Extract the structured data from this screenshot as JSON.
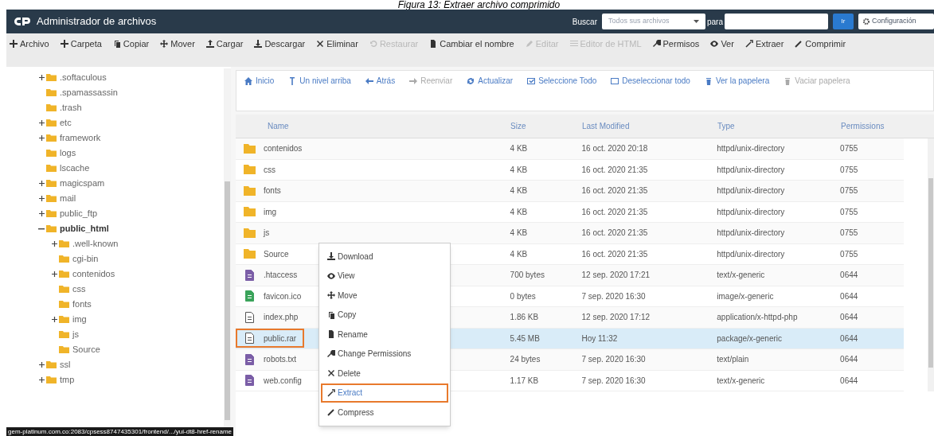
{
  "caption": "Figura 13: Extraer archivo comprimido",
  "header": {
    "title": "Administrador de archivos",
    "search_label": "Buscar",
    "search_scope": "Todos sus archivos",
    "for_label": "para",
    "go_button": "Ir",
    "settings_button": "Configuración"
  },
  "toolbar": [
    {
      "label": "Archivo",
      "disabled": false
    },
    {
      "label": "Carpeta",
      "disabled": false
    },
    {
      "label": "Copiar",
      "disabled": false
    },
    {
      "label": "Mover",
      "disabled": false
    },
    {
      "label": "Cargar",
      "disabled": false
    },
    {
      "label": "Descargar",
      "disabled": false
    },
    {
      "label": "Eliminar",
      "disabled": false
    },
    {
      "label": "Restaurar",
      "disabled": true
    },
    {
      "label": "Cambiar el nombre",
      "disabled": false
    },
    {
      "label": "Editar",
      "disabled": true
    },
    {
      "label": "Editor de HTML",
      "disabled": true
    },
    {
      "label": "Permisos",
      "disabled": false
    },
    {
      "label": "Ver",
      "disabled": false
    },
    {
      "label": "Extraer",
      "disabled": false
    },
    {
      "label": "Comprimir",
      "disabled": false
    }
  ],
  "tree": [
    {
      "label": ".softaculous",
      "expanded": false,
      "selected": false
    },
    {
      "label": ".spamassassin",
      "selected": false
    },
    {
      "label": ".trash",
      "selected": false
    },
    {
      "label": "etc",
      "expanded": false,
      "selected": false
    },
    {
      "label": "framework",
      "expanded": false,
      "selected": false
    },
    {
      "label": "logs",
      "selected": false
    },
    {
      "label": "lscache",
      "selected": false
    },
    {
      "label": "magicspam",
      "expanded": false,
      "selected": false
    },
    {
      "label": "mail",
      "expanded": false,
      "selected": false
    },
    {
      "label": "public_ftp",
      "expanded": false,
      "selected": false
    },
    {
      "label": "public_html",
      "expanded": true,
      "selected": true,
      "children": [
        {
          "label": ".well-known",
          "expanded": false,
          "selected": false
        },
        {
          "label": "cgi-bin",
          "selected": false
        },
        {
          "label": "contenidos",
          "expanded": false,
          "selected": false
        },
        {
          "label": "css",
          "selected": false
        },
        {
          "label": "fonts",
          "selected": false
        },
        {
          "label": "img",
          "expanded": false,
          "selected": false
        },
        {
          "label": "js",
          "selected": false
        },
        {
          "label": "Source",
          "selected": false
        }
      ]
    },
    {
      "label": "ssl",
      "expanded": false,
      "selected": false
    },
    {
      "label": "tmp",
      "expanded": false,
      "selected": false
    }
  ],
  "actions": [
    {
      "label": "Inicio",
      "disabled": false
    },
    {
      "label": "Un nivel arriba",
      "disabled": false
    },
    {
      "label": "Atrás",
      "disabled": false
    },
    {
      "label": "Reenviar",
      "disabled": true
    },
    {
      "label": "Actualizar",
      "disabled": false
    },
    {
      "label": "Seleccione Todo",
      "disabled": false
    },
    {
      "label": "Deseleccionar todo",
      "disabled": false
    },
    {
      "label": "Ver la papelera",
      "disabled": false
    },
    {
      "label": "Vaciar papelera",
      "disabled": true
    }
  ],
  "table": {
    "columns": [
      "Name",
      "Size",
      "Last Modified",
      "Type",
      "Permissions"
    ],
    "rows": [
      {
        "kind": "folder",
        "name": "contenidos",
        "size": "4 KB",
        "modified": "16 oct. 2020 20:18",
        "type": "httpd/unix-directory",
        "permissions": "0755",
        "selected": false,
        "highlighted": false
      },
      {
        "kind": "folder",
        "name": "css",
        "size": "4 KB",
        "modified": "16 oct. 2020 21:35",
        "type": "httpd/unix-directory",
        "permissions": "0755",
        "selected": false,
        "highlighted": false
      },
      {
        "kind": "folder",
        "name": "fonts",
        "size": "4 KB",
        "modified": "16 oct. 2020 21:35",
        "type": "httpd/unix-directory",
        "permissions": "0755",
        "selected": false,
        "highlighted": false
      },
      {
        "kind": "folder",
        "name": "img",
        "size": "4 KB",
        "modified": "16 oct. 2020 21:35",
        "type": "httpd/unix-directory",
        "permissions": "0755",
        "selected": false,
        "highlighted": false
      },
      {
        "kind": "folder",
        "name": "js",
        "size": "4 KB",
        "modified": "16 oct. 2020 21:35",
        "type": "httpd/unix-directory",
        "permissions": "0755",
        "selected": false,
        "highlighted": false
      },
      {
        "kind": "folder",
        "name": "Source",
        "size": "4 KB",
        "modified": "16 oct. 2020 21:35",
        "type": "httpd/unix-directory",
        "permissions": "0755",
        "selected": false,
        "highlighted": false
      },
      {
        "kind": "text",
        "name": ".htaccess",
        "size": "700 bytes",
        "modified": "12 sep. 2020 17:21",
        "type": "text/x-generic",
        "permissions": "0644",
        "selected": false,
        "highlighted": false
      },
      {
        "kind": "image",
        "name": "favicon.ico",
        "size": "0 bytes",
        "modified": "7 sep. 2020 16:30",
        "type": "image/x-generic",
        "permissions": "0644",
        "selected": false,
        "highlighted": false
      },
      {
        "kind": "code",
        "name": "index.php",
        "size": "1.86 KB",
        "modified": "12 sep. 2020 17:12",
        "type": "application/x-httpd-php",
        "permissions": "0644",
        "selected": false,
        "highlighted": false
      },
      {
        "kind": "archive",
        "name": "public.rar",
        "size": "5.45 MB",
        "modified": "Hoy 11:32",
        "type": "package/x-generic",
        "permissions": "0644",
        "selected": true,
        "highlighted": true
      },
      {
        "kind": "text",
        "name": "robots.txt",
        "size": "24 bytes",
        "modified": "7 sep. 2020 16:30",
        "type": "text/plain",
        "permissions": "0644",
        "selected": false,
        "highlighted": false
      },
      {
        "kind": "text",
        "name": "web.config",
        "size": "1.17 KB",
        "modified": "7 sep. 2020 16:30",
        "type": "text/x-generic",
        "permissions": "0644",
        "selected": false,
        "highlighted": false
      }
    ]
  },
  "context_menu": [
    {
      "label": "Download",
      "highlighted": false
    },
    {
      "label": "View",
      "highlighted": false
    },
    {
      "label": "Move",
      "highlighted": false
    },
    {
      "label": "Copy",
      "highlighted": false
    },
    {
      "label": "Rename",
      "highlighted": false
    },
    {
      "label": "Change Permissions",
      "highlighted": false
    },
    {
      "label": "Delete",
      "highlighted": false
    },
    {
      "label": "Extract",
      "highlighted": true
    },
    {
      "label": "Compress",
      "highlighted": false
    }
  ],
  "status_url": "gem-platinum.com.co:2083/cpsess8747435301/frontend/.../yui-dt8-href-rename"
}
